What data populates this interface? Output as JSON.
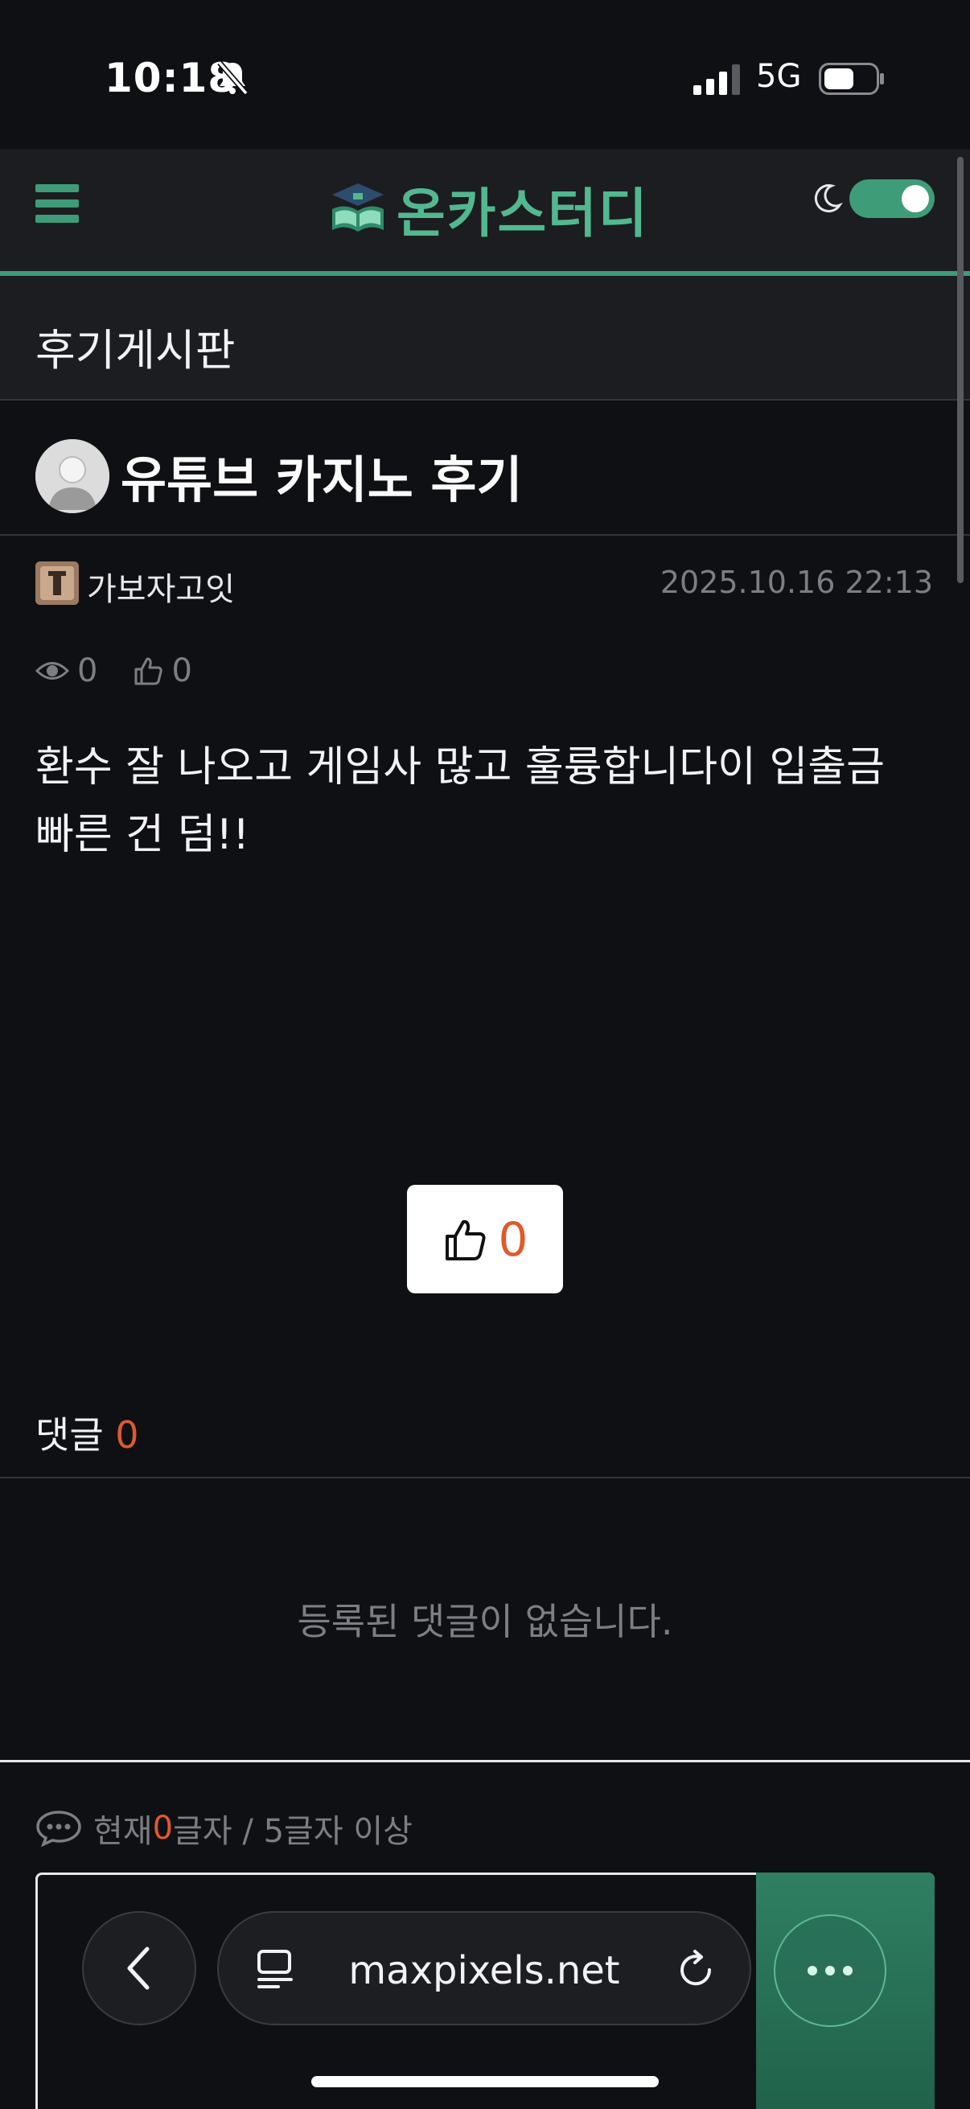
{
  "status_bar": {
    "time": "10:18",
    "network": "5G"
  },
  "header": {
    "logo_text": "온카스터디",
    "dark_mode": true
  },
  "board": {
    "title": "후기게시판"
  },
  "post": {
    "title": "유튜브 카지노 후기",
    "author": "가보자고잇",
    "date": "2025.10.16 22:13",
    "views": "0",
    "likes": "0",
    "body": "환수 잘 나오고 게임사 많고 훌륭합니다이 입출금 빠른 건 덤!!",
    "like_button_count": "0"
  },
  "comments": {
    "label": "댓글",
    "count": "0",
    "empty_message": "등록된 댓글이 없습니다.",
    "char_prefix": "현재 ",
    "char_count": "0",
    "char_suffix": "글자 / 5글자 이상"
  },
  "browser": {
    "url": "maxpixels.net"
  },
  "colors": {
    "accent": "#3f9c78",
    "count": "#e05a2b",
    "background": "#0f1014"
  }
}
